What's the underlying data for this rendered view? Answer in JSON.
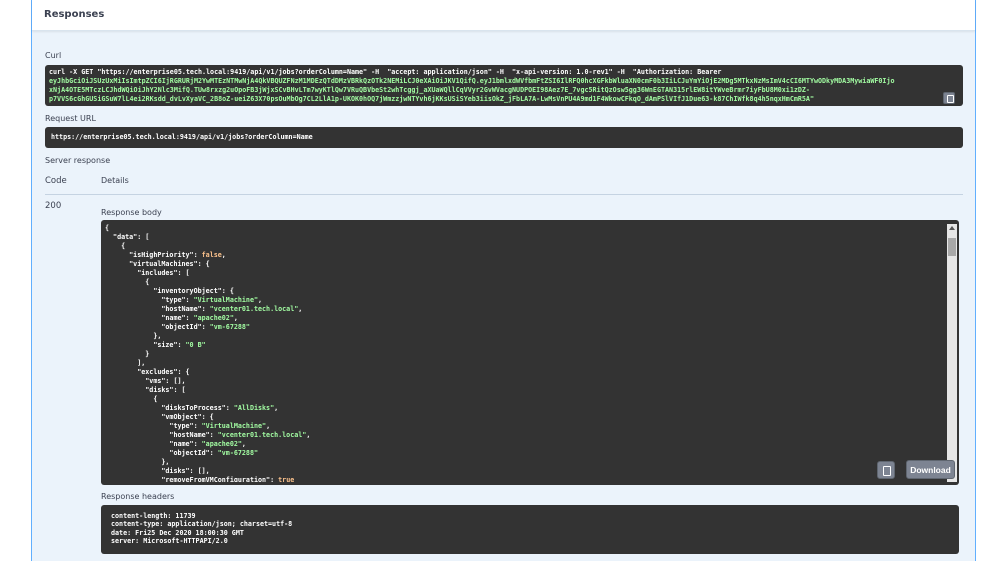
{
  "responses": {
    "title": "Responses"
  },
  "curl": {
    "label": "Curl",
    "line1": "curl -X GET \"https://enterprise05.tech.local:9419/api/v1/jobs?orderColumn=Name\" -H  \"accept: application/json\" -H  \"x-api-version: 1.0-rev1\" -H  \"Authorization: Bearer",
    "line2": "eyJhbGciOiJSUzUxMiIsImtpZCI6IjRGRURjM2YwMTEzNTMwNjA4QkVBQUZFNzM1MDEzQTdDMzVBRkQzOTk2NEMiLCJ0eXAiOiJKV1QifQ.eyJ1bmlxdWVfbmFtZSI6IlRFQ0hcXGFkbWluaXN0cmF0b3IiLCJuYmYiOjE2MDg5MTkxNzMsImV4cCI6MTYwODkyMDA3MywiaWF0Ijo",
    "line3": "xNjA4OTE5MTczLCJhdWQiOiJhY2Nlc3MifQ.TUw8rxzg2uOpoFB3jWjxSCvBHvLTm7wyKTlQw7VRuQBVbeSt2whTcggj_aXUaWQllCqVVyr2GvWVacgNUDPOEI98Aez7E_7vgc5RitQzOsw5gg36WnEGTAN315rlEW8itYWveBrmr7iyFbU8M0xi1zDZ-",
    "line4": "p7VVS6cGhGUSiGSuW7lL4ei2RKsdd_dvLvXyaVC_2B8oZ-ueiZ63X70psOuMbOg7CL2LlA1p-UKOK0hOQ7jWmzzjwNTYvh6jKKsUSiSYeb3iisOkZ_jFbLA7A-LwMsVnPU4A9md1F4WkowCFkqO_dAmPSlVIfJ1Due63-k87ChIWfk8q4h5nqxHmCmR5A\""
  },
  "request_url": {
    "label": "Request URL",
    "value": "https://enterprise05.tech.local:9419/api/v1/jobs?orderColumn=Name"
  },
  "server_response": {
    "label": "Server response",
    "code_header": "Code",
    "details_header": "Details",
    "code": "200",
    "body_label": "Response body",
    "download_label": "Download",
    "headers_label": "Response headers",
    "headers": [
      "content-length: 11739",
      "content-type: application/json; charset=utf-8",
      "date: Fri25 Dec 2020 18:00:30 GMT",
      "server: Microsoft-HTTPAPI/2.0"
    ]
  },
  "json_lines": [
    [
      {
        "t": "{",
        "c": "k"
      }
    ],
    [
      {
        "t": "  \"data\": [",
        "c": "k"
      }
    ],
    [
      {
        "t": "    {",
        "c": "k"
      }
    ],
    [
      {
        "t": "      \"isHighPriority\": ",
        "c": "k"
      },
      {
        "t": "false",
        "c": "b"
      },
      {
        "t": ",",
        "c": "k"
      }
    ],
    [
      {
        "t": "      \"virtualMachines\": {",
        "c": "k"
      }
    ],
    [
      {
        "t": "        \"includes\": [",
        "c": "k"
      }
    ],
    [
      {
        "t": "          {",
        "c": "k"
      }
    ],
    [
      {
        "t": "            \"inventoryObject\": {",
        "c": "k"
      }
    ],
    [
      {
        "t": "              \"type\": ",
        "c": "k"
      },
      {
        "t": "\"VirtualMachine\"",
        "c": "s"
      },
      {
        "t": ",",
        "c": "k"
      }
    ],
    [
      {
        "t": "              \"hostName\": ",
        "c": "k"
      },
      {
        "t": "\"vcenter01.tech.local\"",
        "c": "s"
      },
      {
        "t": ",",
        "c": "k"
      }
    ],
    [
      {
        "t": "              \"name\": ",
        "c": "k"
      },
      {
        "t": "\"apache02\"",
        "c": "s"
      },
      {
        "t": ",",
        "c": "k"
      }
    ],
    [
      {
        "t": "              \"objectId\": ",
        "c": "k"
      },
      {
        "t": "\"vm-67288\"",
        "c": "s"
      }
    ],
    [
      {
        "t": "            },",
        "c": "k"
      }
    ],
    [
      {
        "t": "            \"size\": ",
        "c": "k"
      },
      {
        "t": "\"0 B\"",
        "c": "s"
      }
    ],
    [
      {
        "t": "          }",
        "c": "k"
      }
    ],
    [
      {
        "t": "        ],",
        "c": "k"
      }
    ],
    [
      {
        "t": "        \"excludes\": {",
        "c": "k"
      }
    ],
    [
      {
        "t": "          \"vms\": [],",
        "c": "k"
      }
    ],
    [
      {
        "t": "          \"disks\": [",
        "c": "k"
      }
    ],
    [
      {
        "t": "            {",
        "c": "k"
      }
    ],
    [
      {
        "t": "              \"disksToProcess\": ",
        "c": "k"
      },
      {
        "t": "\"AllDisks\"",
        "c": "s"
      },
      {
        "t": ",",
        "c": "k"
      }
    ],
    [
      {
        "t": "              \"vmObject\": {",
        "c": "k"
      }
    ],
    [
      {
        "t": "                \"type\": ",
        "c": "k"
      },
      {
        "t": "\"VirtualMachine\"",
        "c": "s"
      },
      {
        "t": ",",
        "c": "k"
      }
    ],
    [
      {
        "t": "                \"hostName\": ",
        "c": "k"
      },
      {
        "t": "\"vcenter01.tech.local\"",
        "c": "s"
      },
      {
        "t": ",",
        "c": "k"
      }
    ],
    [
      {
        "t": "                \"name\": ",
        "c": "k"
      },
      {
        "t": "\"apache02\"",
        "c": "s"
      },
      {
        "t": ",",
        "c": "k"
      }
    ],
    [
      {
        "t": "                \"objectId\": ",
        "c": "k"
      },
      {
        "t": "\"vm-67288\"",
        "c": "s"
      }
    ],
    [
      {
        "t": "              },",
        "c": "k"
      }
    ],
    [
      {
        "t": "              \"disks\": [],",
        "c": "k"
      }
    ],
    [
      {
        "t": "              \"removeFromVMConfiguration\": ",
        "c": "k"
      },
      {
        "t": "true",
        "c": "b"
      }
    ]
  ]
}
